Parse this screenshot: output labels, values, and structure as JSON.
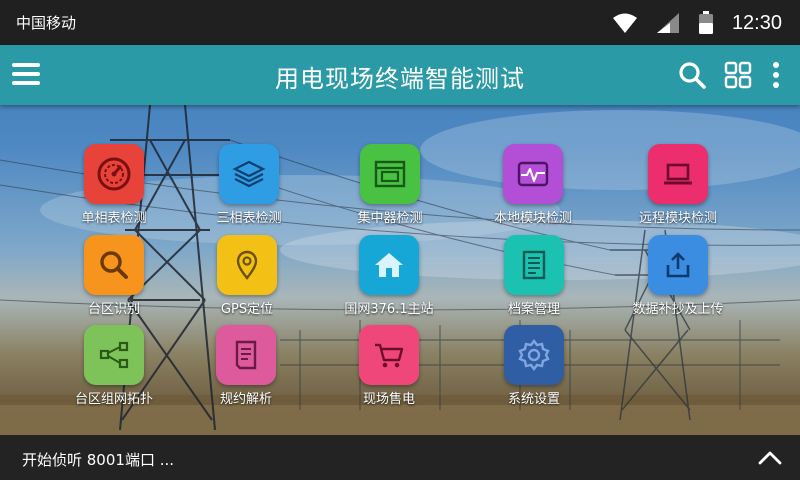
{
  "status": {
    "carrier": "中国移动",
    "time": "12:30",
    "icons": [
      "wifi-icon",
      "cell-signal-icon",
      "battery-icon"
    ]
  },
  "appbar": {
    "title": "用电现场终端智能测试",
    "icons": [
      "menu-icon",
      "search-icon",
      "grid-view-icon",
      "more-vertical-icon"
    ]
  },
  "tiles": [
    {
      "label": "单相表检测",
      "icon": "gauge-icon",
      "color": "#e8433a"
    },
    {
      "label": "三相表检测",
      "icon": "layers-icon",
      "color": "#2f9de4"
    },
    {
      "label": "集中器检测",
      "icon": "concentrator-icon",
      "color": "#49c244"
    },
    {
      "label": "本地模块检测",
      "icon": "waveform-monitor-icon",
      "color": "#b24fd6"
    },
    {
      "label": "远程模块检测",
      "icon": "laptop-icon",
      "color": "#ec2d6e"
    },
    {
      "label": "台区识别",
      "icon": "magnifier-icon",
      "color": "#f6941e"
    },
    {
      "label": "GPS定位",
      "icon": "location-pin-icon",
      "color": "#f3c116"
    },
    {
      "label": "国网376.1主站",
      "icon": "home-icon",
      "color": "#17a7d6"
    },
    {
      "label": "档案管理",
      "icon": "document-icon",
      "color": "#1cc2b1"
    },
    {
      "label": "数据补抄及上传",
      "icon": "upload-icon",
      "color": "#3b8de2"
    },
    {
      "label": "台区组网拓扑",
      "icon": "share-icon",
      "color": "#7dc35a"
    },
    {
      "label": "规约解析",
      "icon": "notes-icon",
      "color": "#dd5b9c"
    },
    {
      "label": "现场售电",
      "icon": "cart-icon",
      "color": "#f0477a"
    },
    {
      "label": "系统设置",
      "icon": "gear-icon",
      "color": "#2f5ea4"
    }
  ],
  "bottom": {
    "message": "开始侦听 8001端口 ...",
    "expand_icon": "chevron-up-icon"
  }
}
